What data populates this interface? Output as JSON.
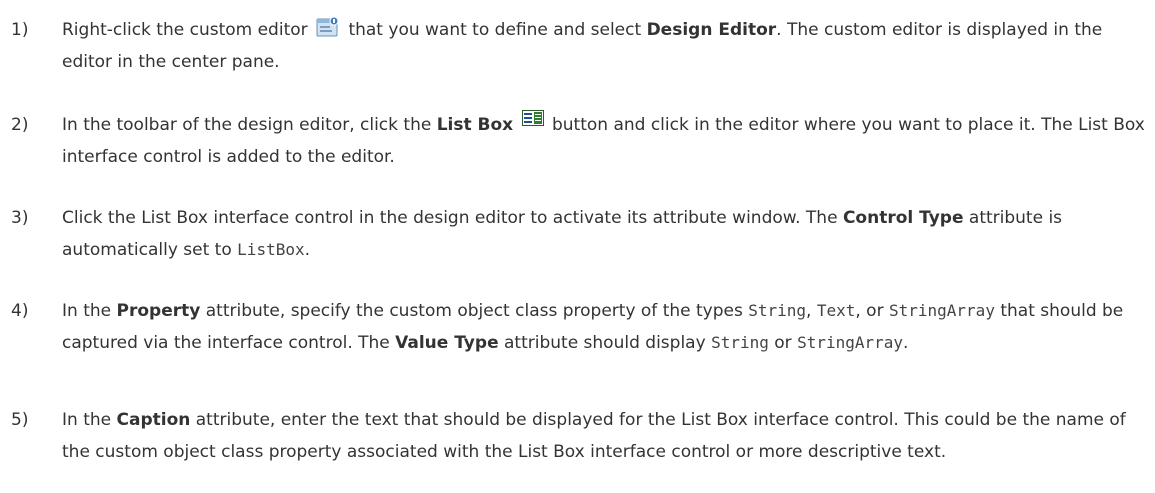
{
  "steps": [
    {
      "number": "1)",
      "t1": "Right-click the custom editor",
      "t2": "that you want to define and select",
      "b1": "Design Editor",
      "t3": ". The custom editor is displayed in the editor in the center pane.",
      "icon": "custom-editor-icon"
    },
    {
      "number": "2)",
      "t1": "In the toolbar of the design editor, click the",
      "b1": "List Box",
      "t2": "button and click in the editor where you want to place it. The List Box interface control is added to the editor.",
      "icon": "list-box-icon"
    },
    {
      "number": "3)",
      "t1": "Click the List Box interface control in the design editor to activate its attribute window. The",
      "b1": "Control Type",
      "t2": "attribute is automatically set to",
      "c1": "ListBox",
      "t3": "."
    },
    {
      "number": "4)",
      "t1": "In the",
      "b1": "Property",
      "t2": "attribute, specify the custom object class property of the types",
      "c1": "String",
      "t3": ",",
      "c2": "Text",
      "t4": ", or",
      "c3": "StringArray",
      "t5": "that should be captured via the interface control. The",
      "b2": "Value Type",
      "t6": "attribute should display",
      "c4": "String",
      "t7": "or",
      "c5": "StringArray",
      "t8": "."
    },
    {
      "number": "5)",
      "t1": "In the",
      "b1": "Caption",
      "t2": "attribute, enter the text that should be displayed for the List Box interface control. This could be the name of the custom object class property associated with the List Box interface control or more descriptive text."
    }
  ],
  "colors": {
    "text": "#333333",
    "code": "#444444"
  }
}
